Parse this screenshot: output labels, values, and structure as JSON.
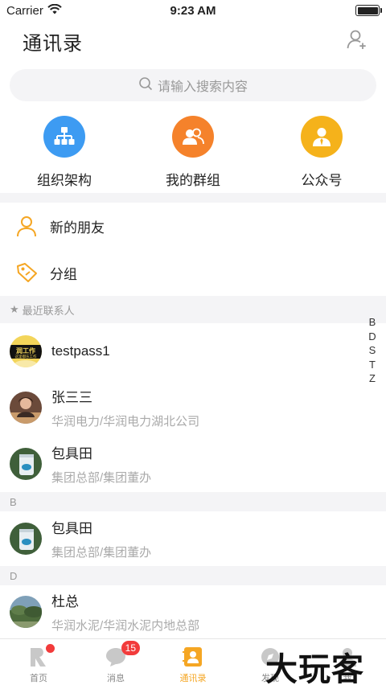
{
  "status_bar": {
    "carrier": "Carrier",
    "time": "9:23 AM"
  },
  "header": {
    "title": "通讯录",
    "add_friend_icon": "person-add-icon"
  },
  "search": {
    "placeholder": "请输入搜索内容"
  },
  "quick_actions": [
    {
      "label": "组织架构",
      "icon": "org-chart-icon",
      "color": "#3d9bf2"
    },
    {
      "label": "我的群组",
      "icon": "group-icon",
      "color": "#f5822b"
    },
    {
      "label": "公众号",
      "icon": "official-account-icon",
      "color": "#f5b21b"
    }
  ],
  "menu": [
    {
      "label": "新的朋友",
      "icon": "person-icon"
    },
    {
      "label": "分组",
      "icon": "tag-icon"
    }
  ],
  "recent_section": {
    "label": "最近联系人"
  },
  "recent_contacts": [
    {
      "name": "testpass1",
      "sub": "",
      "avatar_text_1": "润工作",
      "avatar_text_2": "这里都乐工作"
    },
    {
      "name": "张三三",
      "sub": "华润电力/华润电力湖北公司"
    },
    {
      "name": "包具田",
      "sub": "集团总部/集团董办"
    }
  ],
  "sections": [
    {
      "letter": "B",
      "contacts": [
        {
          "name": "包具田",
          "sub": "集团总部/集团董办"
        }
      ]
    },
    {
      "letter": "D",
      "contacts": [
        {
          "name": "杜总",
          "sub": "华润水泥/华润水泥内地总部"
        }
      ]
    }
  ],
  "index_letters": [
    "B",
    "D",
    "S",
    "T",
    "Z"
  ],
  "tabs": [
    {
      "label": "首页",
      "icon": "home-icon",
      "dot": true
    },
    {
      "label": "消息",
      "icon": "message-icon",
      "badge": "15"
    },
    {
      "label": "通讯录",
      "icon": "contacts-icon",
      "active": true
    },
    {
      "label": "发现",
      "icon": "discover-icon"
    },
    {
      "label": "我",
      "icon": "me-icon"
    }
  ],
  "watermark": "大玩客",
  "colors": {
    "accent": "#f5a623",
    "badge": "#f23b3b",
    "band": "#f4f4f6"
  }
}
